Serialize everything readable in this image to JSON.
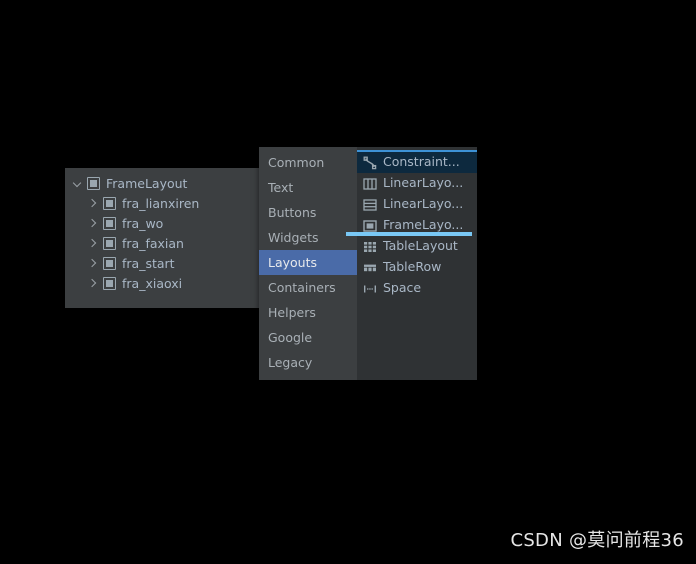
{
  "component_tree": {
    "rows": [
      {
        "label": "FrameLayout",
        "expanded": true,
        "depth": 0,
        "icon": "frame-layout-icon"
      },
      {
        "label": "fra_lianxiren",
        "expanded": false,
        "depth": 1,
        "icon": "frame-layout-icon"
      },
      {
        "label": "fra_wo",
        "expanded": false,
        "depth": 1,
        "icon": "frame-layout-icon"
      },
      {
        "label": "fra_faxian",
        "expanded": false,
        "depth": 1,
        "icon": "frame-layout-icon"
      },
      {
        "label": "fra_start",
        "expanded": false,
        "depth": 1,
        "icon": "frame-layout-icon"
      },
      {
        "label": "fra_xiaoxi",
        "expanded": false,
        "depth": 1,
        "icon": "frame-layout-icon"
      }
    ]
  },
  "palette": {
    "categories": [
      {
        "label": "Common",
        "selected": false
      },
      {
        "label": "Text",
        "selected": false
      },
      {
        "label": "Buttons",
        "selected": false
      },
      {
        "label": "Widgets",
        "selected": false
      },
      {
        "label": "Layouts",
        "selected": true
      },
      {
        "label": "Containers",
        "selected": false
      },
      {
        "label": "Helpers",
        "selected": false
      },
      {
        "label": "Google",
        "selected": false
      },
      {
        "label": "Legacy",
        "selected": false
      }
    ],
    "items": [
      {
        "label": "Constraint...",
        "icon": "constraint-layout-icon",
        "selected": true
      },
      {
        "label": "LinearLayo...",
        "icon": "linear-layout-horizontal-icon",
        "selected": false
      },
      {
        "label": "LinearLayo...",
        "icon": "linear-layout-vertical-icon",
        "selected": false
      },
      {
        "label": "FrameLayo...",
        "icon": "frame-layout-icon",
        "selected": false
      },
      {
        "label": "TableLayout",
        "icon": "table-layout-icon",
        "selected": false
      },
      {
        "label": "TableRow",
        "icon": "table-row-icon",
        "selected": false
      },
      {
        "label": "Space",
        "icon": "space-icon",
        "selected": false
      }
    ],
    "drop_indicator_after_index": 3
  },
  "colors": {
    "panel_background": "#3c3f41",
    "items_background": "#2f3234",
    "selection_blue": "#4a6ba8",
    "item_selection": "#0d293e",
    "accent_line": "#3d92d6",
    "drop_indicator": "#79c8f5",
    "text": "#a9b7c6",
    "page_background": "#000000"
  },
  "watermark": {
    "text": "CSDN @莫问前程36"
  }
}
